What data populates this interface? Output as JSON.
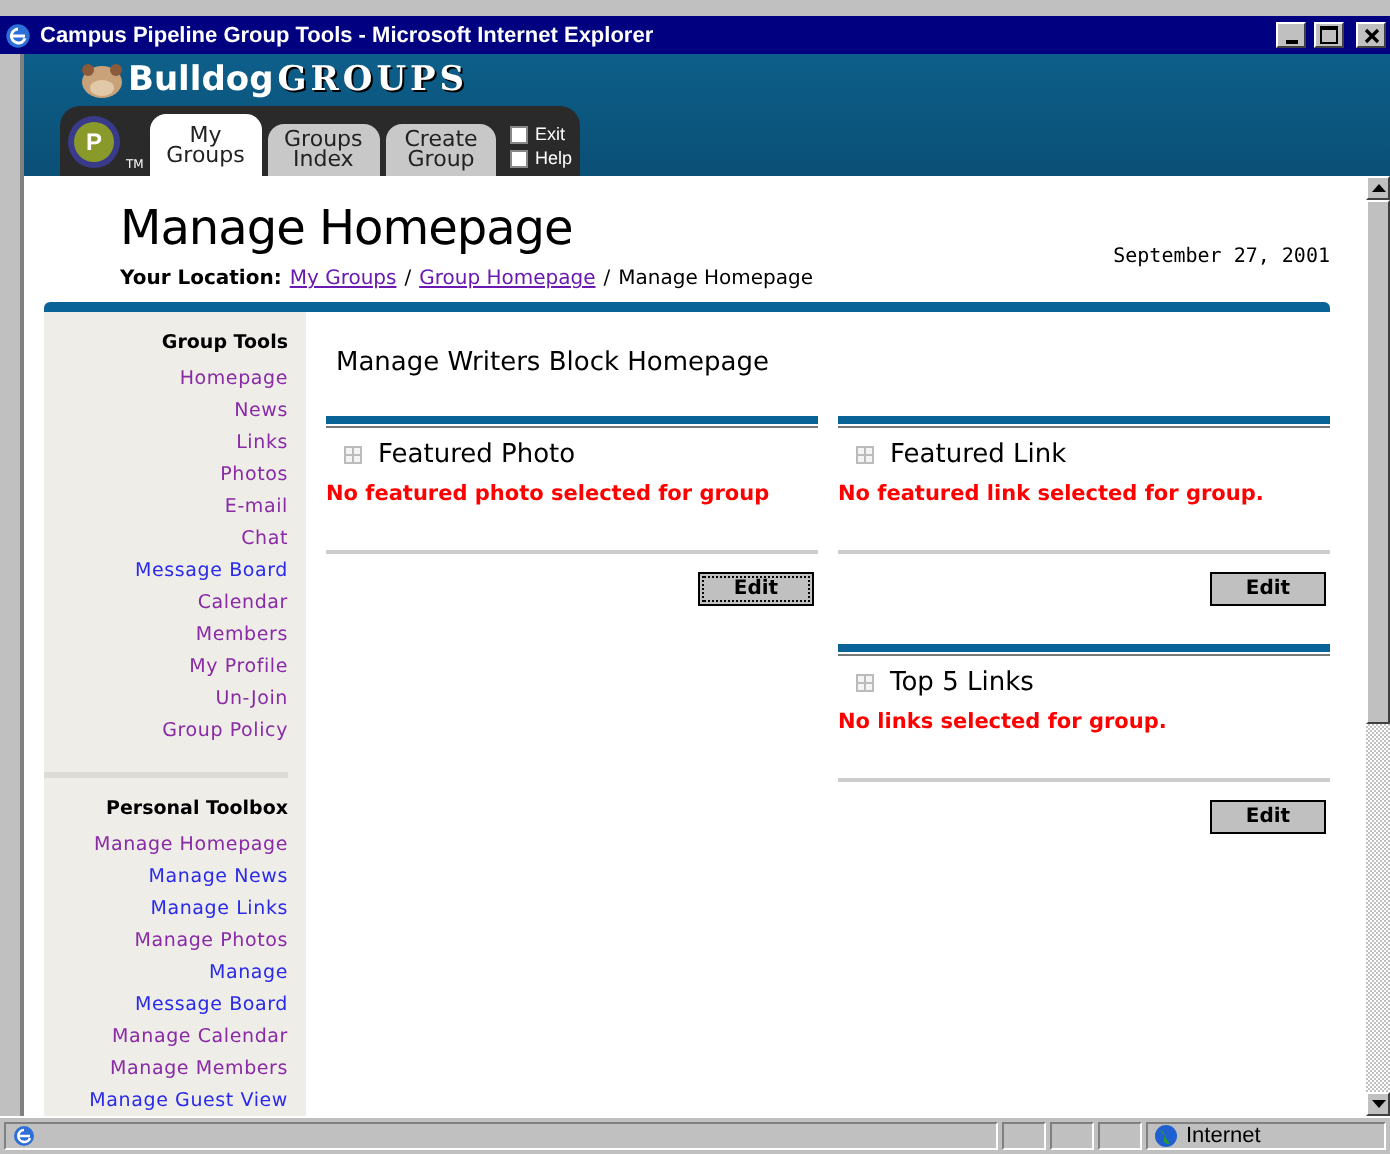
{
  "window": {
    "title": "Campus Pipeline Group Tools - Microsoft Internet Explorer"
  },
  "header": {
    "logo_left": "Bulldog",
    "logo_right": "GROUPS",
    "badge": "P",
    "trademark": "TM",
    "tabs": [
      {
        "label": "My\nGroups",
        "selected": true
      },
      {
        "label": "Groups\nIndex",
        "selected": false
      },
      {
        "label": "Create\nGroup",
        "selected": false
      }
    ],
    "tools": [
      "Exit",
      "Help"
    ]
  },
  "page": {
    "title": "Manage Homepage",
    "date": "September 27, 2001",
    "location_label": "Your Location:",
    "separators": [
      "/",
      "/"
    ],
    "breadcrumb": [
      {
        "label": "My Groups",
        "link": true
      },
      {
        "label": "Group Homepage",
        "link": true
      },
      {
        "label": "Manage Homepage",
        "link": false
      }
    ]
  },
  "sidebar": [
    {
      "heading": "Group Tools",
      "items": [
        {
          "label": "Homepage",
          "visited": true
        },
        {
          "label": "News",
          "visited": true
        },
        {
          "label": "Links",
          "visited": true
        },
        {
          "label": "Photos",
          "visited": true
        },
        {
          "label": "E-mail",
          "visited": true
        },
        {
          "label": "Chat",
          "visited": true
        },
        {
          "label": "Message Board",
          "visited": false
        },
        {
          "label": "Calendar",
          "visited": true
        },
        {
          "label": "Members",
          "visited": true
        },
        {
          "label": "My Profile",
          "visited": true
        },
        {
          "label": "Un-Join",
          "visited": true
        },
        {
          "label": "Group Policy",
          "visited": true
        }
      ]
    },
    {
      "heading": "Personal Toolbox",
      "items": [
        {
          "label": "Manage Homepage",
          "visited": true
        },
        {
          "label": "Manage News",
          "visited": false
        },
        {
          "label": "Manage Links",
          "visited": false
        },
        {
          "label": "Manage Photos",
          "visited": true
        },
        {
          "label": "Manage\nMessage Board",
          "visited": false
        },
        {
          "label": "Manage Calendar",
          "visited": true
        },
        {
          "label": "Manage Members",
          "visited": true
        },
        {
          "label": "Manage Guest View",
          "visited": false
        }
      ]
    }
  ],
  "main": {
    "heading": "Manage Writers Block Homepage",
    "columns": [
      [
        {
          "title": "Featured Photo",
          "message": "No featured photo selected for group",
          "button": "Edit",
          "focused": true
        }
      ],
      [
        {
          "title": "Featured Link",
          "message": "No featured link selected for group.",
          "button": "Edit",
          "focused": false
        },
        {
          "title": "Top 5 Links",
          "message": "No links selected for group.",
          "button": "Edit",
          "focused": false
        }
      ]
    ]
  },
  "status_bar": {
    "zone": "Internet"
  }
}
